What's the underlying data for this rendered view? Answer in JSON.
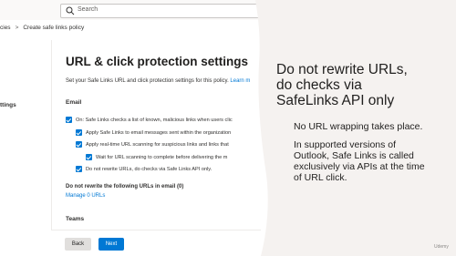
{
  "topbar": {
    "search_placeholder": "Search",
    "search_icon": "search-icon"
  },
  "breadcrumb": {
    "items": [
      "cies",
      "Create safe links policy"
    ],
    "separator": ">"
  },
  "nav": {
    "settings_label": "ttings"
  },
  "panel": {
    "title": "URL & click protection settings",
    "subtitle": "Set your Safe Links URL and click protection settings for this policy.",
    "subtitle_link": "Learn m",
    "email_section": "Email",
    "checkboxes": [
      {
        "label": "On: Safe Links checks a list of known, malicious links when users clic",
        "checked": true
      },
      {
        "label": "Apply Safe Links to email messages sent within the organization",
        "checked": true
      },
      {
        "label": "Apply real-time URL scanning for suspicious links and links that",
        "checked": true
      },
      {
        "label": "Wait for URL scanning to complete before delivering the m",
        "checked": true
      },
      {
        "label": "Do not rewrite URLs, do checks via Safe Links API only.",
        "checked": true
      }
    ],
    "do_not_rewrite_heading": "Do not rewrite the following URLs in email (0)",
    "manage_link": "Manage 0 URLs",
    "teams_section": "Teams",
    "back_label": "Back",
    "next_label": "Next"
  },
  "overlay": {
    "title_lines": [
      "Do not rewrite URLs,",
      "do checks via",
      "SafeLinks API only"
    ],
    "paragraph1": "No URL wrapping takes place.",
    "paragraph2_lines": [
      "In supported versions of",
      "Outlook, Safe Links is called",
      "exclusively via APIs at the time",
      "of URL click."
    ],
    "watermark": "Udemy"
  },
  "colors": {
    "accent": "#0078d4",
    "overlay_bg": "#f5f2f0"
  }
}
